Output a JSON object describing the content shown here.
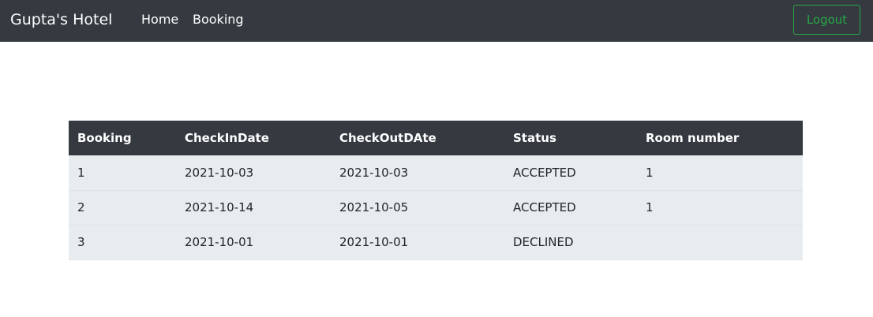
{
  "navbar": {
    "brand": "Gupta's Hotel",
    "links": [
      {
        "label": "Home"
      },
      {
        "label": "Booking"
      }
    ],
    "logout_label": "Logout"
  },
  "table": {
    "headers": [
      "Booking",
      "CheckInDate",
      "CheckOutDAte",
      "Status",
      "Room number"
    ],
    "rows": [
      {
        "booking": "1",
        "checkin": "2021-10-03",
        "checkout": "2021-10-03",
        "status": "ACCEPTED",
        "room": "1"
      },
      {
        "booking": "2",
        "checkin": "2021-10-14",
        "checkout": "2021-10-05",
        "status": "ACCEPTED",
        "room": "1"
      },
      {
        "booking": "3",
        "checkin": "2021-10-01",
        "checkout": "2021-10-01",
        "status": "DECLINED",
        "room": ""
      }
    ]
  },
  "colors": {
    "navbar_bg": "#343a40",
    "logout_accent": "#28a745",
    "row_bg": "#e9ecef"
  }
}
